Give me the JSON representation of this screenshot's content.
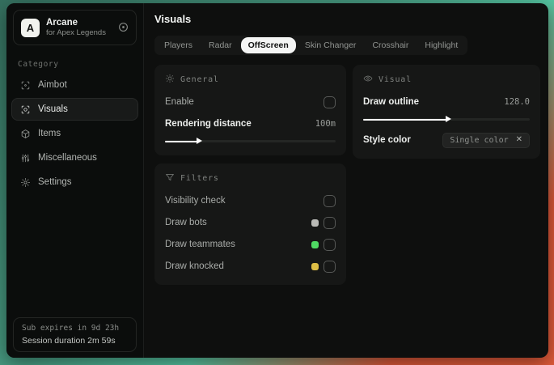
{
  "app": {
    "logo_letter": "A",
    "name": "Arcane",
    "subtitle": "for Apex Legends"
  },
  "sidebar": {
    "category_label": "Category",
    "items": [
      {
        "label": "Aimbot",
        "icon": "crosshair-icon",
        "selected": false
      },
      {
        "label": "Visuals",
        "icon": "eye-scan-icon",
        "selected": true
      },
      {
        "label": "Items",
        "icon": "cube-icon",
        "selected": false
      },
      {
        "label": "Miscellaneous",
        "icon": "sliders-icon",
        "selected": false
      },
      {
        "label": "Settings",
        "icon": "gear-icon",
        "selected": false
      }
    ],
    "footer": {
      "sub_expires": "Sub expires in 9d 23h",
      "session_duration": "Session duration 2m 59s"
    }
  },
  "main": {
    "title": "Visuals",
    "tabs": [
      {
        "label": "Players",
        "active": false
      },
      {
        "label": "Radar",
        "active": false
      },
      {
        "label": "OffScreen",
        "active": true
      },
      {
        "label": "Skin Changer",
        "active": false
      },
      {
        "label": "Crosshair",
        "active": false
      },
      {
        "label": "Highlight",
        "active": false
      }
    ],
    "general": {
      "title": "General",
      "enable_label": "Enable",
      "enable_checked": false,
      "distance_label": "Rendering distance",
      "distance_value": "100m",
      "distance_percent": 19
    },
    "visual": {
      "title": "Visual",
      "outline_label": "Draw outline",
      "outline_value": "128.0",
      "outline_percent": 50,
      "style_label": "Style color",
      "style_value": "Single color",
      "style_clear_glyph": "✕"
    },
    "filters": {
      "title": "Filters",
      "rows": [
        {
          "label": "Visibility check",
          "swatch": null,
          "checked": false
        },
        {
          "label": "Draw bots",
          "swatch": "#b9bab6",
          "checked": false
        },
        {
          "label": "Draw teammates",
          "swatch": "#4fd963",
          "checked": false
        },
        {
          "label": "Draw knocked",
          "swatch": "#ddbe45",
          "checked": false
        }
      ]
    }
  },
  "colors": {
    "accent_green": "#4fd963",
    "accent_yellow": "#ddbe45",
    "swatch_gray": "#b9bab6",
    "bg_teal": "#46987f",
    "bg_red": "#e05a39",
    "panel": "#161716",
    "sidebar": "#0b0d0c"
  }
}
